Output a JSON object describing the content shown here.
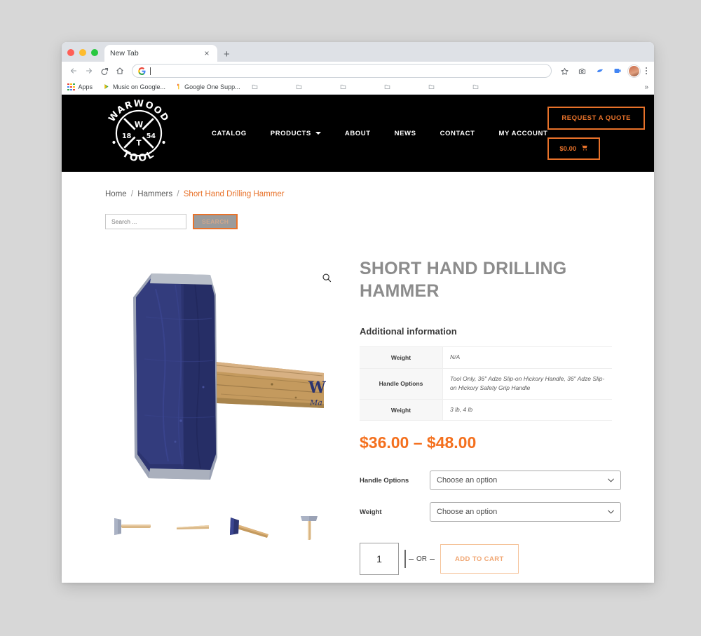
{
  "browser": {
    "tab_title": "New Tab",
    "tab_close_label": "×",
    "new_tab_label": "+",
    "omnibox_value": "",
    "omnibox_placeholder": "",
    "back_icon": "back-arrow-icon",
    "forward_icon": "forward-arrow-icon",
    "reload_icon": "reload-icon",
    "home_icon": "home-icon",
    "star_icon": "bookmark-star-icon",
    "camera_icon": "screenshot-camera-icon",
    "extension_icon": "extension-icon",
    "meet_icon": "google-meet-icon",
    "profile_icon": "profile-avatar-icon",
    "menu_icon": "three-dot-menu-icon",
    "bookmarks": [
      {
        "label": "Apps",
        "icon": "apps-grid-icon"
      },
      {
        "label": "Music on Google...",
        "icon": "play-music-icon"
      },
      {
        "label": "Google One Supp...",
        "icon": "google-one-icon"
      },
      {
        "label": "",
        "icon": "folder-icon"
      },
      {
        "label": "",
        "icon": "folder-icon"
      },
      {
        "label": "",
        "icon": "folder-icon"
      },
      {
        "label": "",
        "icon": "folder-icon"
      },
      {
        "label": "",
        "icon": "folder-icon"
      },
      {
        "label": "",
        "icon": "folder-icon"
      }
    ],
    "bookmarks_overflow": "»"
  },
  "site": {
    "logo": {
      "top_text": "WARWOOD",
      "bottom_text": "TOOL",
      "center_top": "W",
      "center_bottom": "T",
      "year_left": "18",
      "year_right": "54"
    },
    "nav": [
      {
        "label": "CATALOG",
        "has_dropdown": false
      },
      {
        "label": "PRODUCTS",
        "has_dropdown": true
      },
      {
        "label": "ABOUT",
        "has_dropdown": false
      },
      {
        "label": "NEWS",
        "has_dropdown": false
      },
      {
        "label": "CONTACT",
        "has_dropdown": false
      },
      {
        "label": "MY ACCOUNT",
        "has_dropdown": false
      }
    ],
    "quote_button": "REQUEST A QUOTE",
    "cart_amount": "$0.00",
    "colors": {
      "accent_orange": "#e8722a",
      "price_orange": "#f4701e",
      "header_bg": "#000000"
    }
  },
  "breadcrumb": {
    "home": "Home",
    "category": "Hammers",
    "current": "Short Hand Drilling Hammer",
    "separator": "/"
  },
  "search": {
    "placeholder": "Search ...",
    "value": "",
    "button_label": "SEARCH"
  },
  "product": {
    "title": "SHORT HAND DRILLING HAMMER",
    "zoom_icon": "magnifier-zoom-icon",
    "additional_info_heading": "Additional information",
    "additional_info": [
      {
        "label": "Weight",
        "value": "N/A"
      },
      {
        "label": "Handle Options",
        "value": "Tool Only, 36″ Adze Slip-on Hickory Handle, 36″ Adze Slip-on Hickory Safety Grip Handle"
      },
      {
        "label": "Weight",
        "value": "3 lb, 4 lb"
      }
    ],
    "price": "$36.00 – $48.00",
    "variations": [
      {
        "label": "Handle Options",
        "selected": "Choose an option"
      },
      {
        "label": "Weight",
        "selected": "Choose an option"
      }
    ],
    "quantity": "1",
    "or_label": "OR",
    "add_to_cart_label": "ADD TO CART",
    "thumbnails": [
      {
        "name": "gray-head-hammer-thumbnail"
      },
      {
        "name": "wood-handle-only-thumbnail"
      },
      {
        "name": "blue-head-hammer-angled-thumbnail"
      },
      {
        "name": "gray-head-hammer-vertical-thumbnail"
      }
    ]
  }
}
